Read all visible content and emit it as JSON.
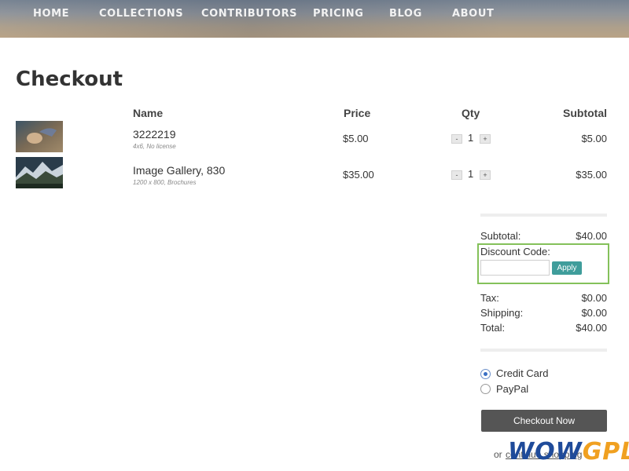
{
  "nav": {
    "items": [
      "HOME",
      "COLLECTIONS",
      "CONTRIBUTORS",
      "PRICING",
      "BLOG",
      "ABOUT"
    ]
  },
  "page_title": "Checkout",
  "table": {
    "headers": {
      "name": "Name",
      "price": "Price",
      "qty": "Qty",
      "subtotal": "Subtotal"
    },
    "rows": [
      {
        "name": "3222219",
        "meta": "4x6, No license",
        "price": "$5.00",
        "qty": "1",
        "subtotal": "$5.00",
        "minus": "-",
        "plus": "+"
      },
      {
        "name": "Image Gallery, 830",
        "meta": "1200 x 800, Brochures",
        "price": "$35.00",
        "qty": "1",
        "subtotal": "$35.00",
        "minus": "-",
        "plus": "+"
      }
    ]
  },
  "summary": {
    "subtotal_label": "Subtotal:",
    "subtotal_value": "$40.00",
    "discount_label": "Discount Code:",
    "discount_value": "",
    "apply_label": "Apply",
    "tax_label": "Tax:",
    "tax_value": "$0.00",
    "shipping_label": "Shipping:",
    "shipping_value": "$0.00",
    "total_label": "Total:",
    "total_value": "$40.00"
  },
  "payment": {
    "options": [
      {
        "label": "Credit Card",
        "selected": true
      },
      {
        "label": "PayPal",
        "selected": false
      }
    ]
  },
  "checkout_label": "Checkout Now",
  "or_text": "or",
  "continue_label": "continue shopping",
  "watermark": {
    "part1": "WOW",
    "part2": "GPL"
  },
  "colors": {
    "accent": "#3f9d9b",
    "highlight": "#84c15a",
    "checkout": "#555555"
  }
}
